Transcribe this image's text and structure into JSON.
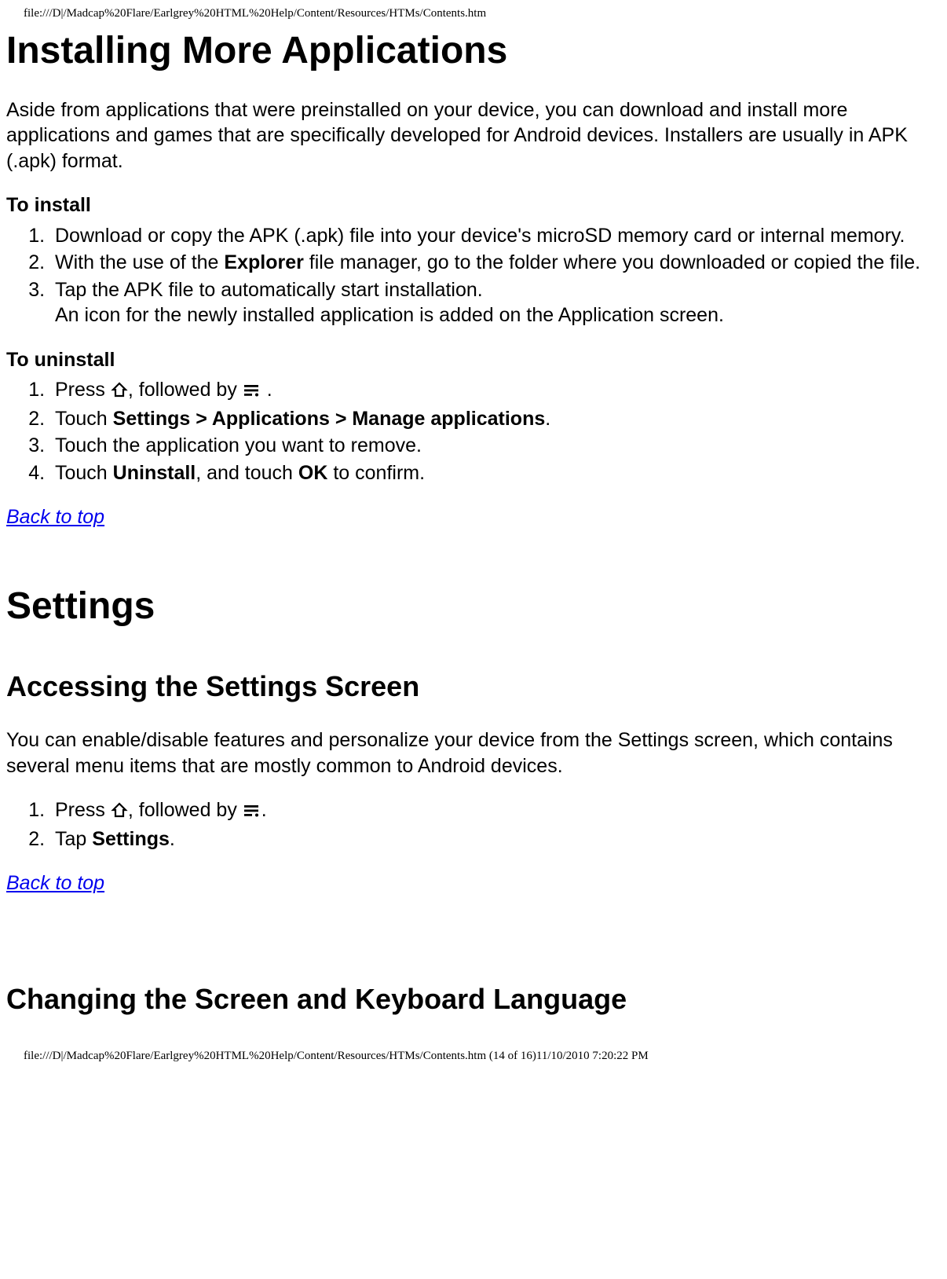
{
  "header_path": "file:///D|/Madcap%20Flare/Earlgrey%20HTML%20Help/Content/Resources/HTMs/Contents.htm",
  "footer_path": "file:///D|/Madcap%20Flare/Earlgrey%20HTML%20Help/Content/Resources/HTMs/Contents.htm (14 of 16)11/10/2010 7:20:22 PM",
  "h1_installing": "Installing More Applications",
  "intro_p": "Aside from applications that were preinstalled on your device, you can download and install more applications and games that are specifically developed for Android devices. Installers are usually in APK (.apk) format.",
  "to_install_label": "To install",
  "install_steps": {
    "s1": "Download or copy the APK (.apk) file into your device's microSD memory card or internal memory.",
    "s2_a": "With the use of the ",
    "s2_bold": "Explorer",
    "s2_b": " file manager, go to the folder where you downloaded or copied the file.",
    "s3_line1": "Tap the APK file to automatically start installation.",
    "s3_line2": "An icon for the newly installed application is added on the Application screen."
  },
  "to_uninstall_label": "To uninstall",
  "uninstall_steps": {
    "s1_a": "Press ",
    "s1_b": ", followed by ",
    "s1_c": " .",
    "s2_a": "Touch ",
    "s2_bold": "Settings > Applications > Manage applications",
    "s2_b": ".",
    "s3": "Touch the application you want to remove.",
    "s4_a": "Touch ",
    "s4_bold1": "Uninstall",
    "s4_b": ", and touch ",
    "s4_bold2": "OK",
    "s4_c": " to confirm."
  },
  "back_to_top": "Back to top",
  "h1_settings": "Settings",
  "h2_accessing": "Accessing the Settings Screen",
  "settings_intro": "You can enable/disable features and personalize your device from the Settings screen, which contains several menu items that are mostly common to Android devices.",
  "settings_steps": {
    "s1_a": "Press ",
    "s1_b": ", followed by ",
    "s1_c": ".",
    "s2_a": "Tap ",
    "s2_bold": "Settings",
    "s2_b": "."
  },
  "h2_changing": "Changing the Screen and Keyboard Language",
  "icons": {
    "home": "home-icon",
    "menu": "menu-icon"
  }
}
